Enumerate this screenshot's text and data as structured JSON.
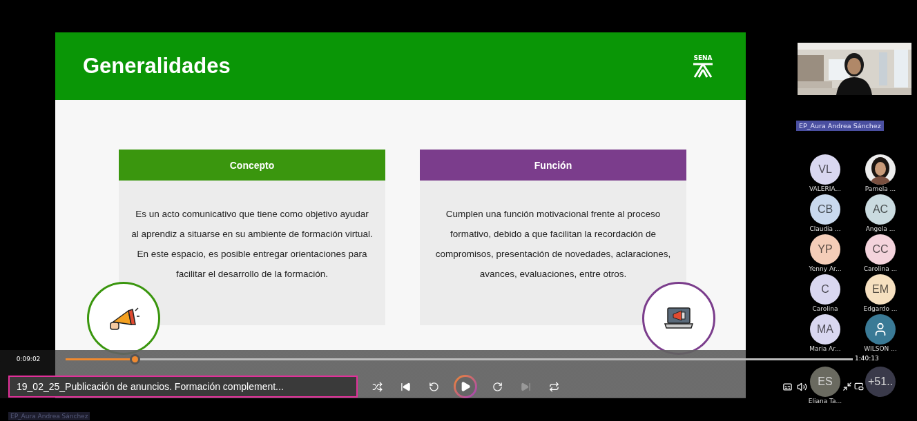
{
  "slide": {
    "title": "Generalidades",
    "logo": "SENA",
    "cards": [
      {
        "heading": "Concepto",
        "color": "#3a960e",
        "kind": "megaphone",
        "body": "Es un acto comunicativo que tiene como objetivo ayudar al aprendiz a situarse en su ambiente de formación virtual. En este espacio, es posible entregar orientaciones para facilitar el desarrollo de la formación."
      },
      {
        "heading": "Función",
        "color": "#7b3d8c",
        "kind": "laptop",
        "body": "Cumplen una función motivacional frente al proceso formativo, debido a que facilitan la recordación de compromisos, presentación de novedades, aclaraciones, avances, evaluaciones, entre otros."
      }
    ]
  },
  "player": {
    "elapsed": "0:09:02",
    "duration": "1:40:13",
    "level": 0.088,
    "title": "19_02_25_Publicación de anuncios. Formación complement..."
  },
  "meeting": {
    "presenter": {
      "name": "EP_Aura Andrea Sánchez",
      "kind": "picture"
    },
    "participants": [
      {
        "kind": "initials",
        "initials": "VL",
        "name": "VALERIA...",
        "color": "#d9d7f0"
      },
      {
        "name": "Pamela ..."
      },
      {
        "kind": "initials",
        "initials": "CB",
        "name": "Claudia ...",
        "color": "#c9d9ee"
      },
      {
        "kind": "initials",
        "initials": "AC",
        "name": "Angela ...",
        "color": "#cadbe0"
      },
      {
        "kind": "initials",
        "initials": "YP",
        "name": "Yenny Ar...",
        "color": "#f4cdb8"
      },
      {
        "kind": "initials",
        "initials": "CC",
        "name": "Carolina ...",
        "color": "#f4d3dc"
      },
      {
        "kind": "initials",
        "initials": "C",
        "name": "Carolina",
        "color": "#d9d7f0"
      },
      {
        "kind": "initials",
        "initials": "EM",
        "name": "Edgardo ...",
        "color": "#f6e0c0"
      },
      {
        "kind": "initials",
        "initials": "MA",
        "name": "Maria Ar...",
        "color": "#d9d7f0"
      },
      {
        "kind": "icon",
        "name": "WILSON ...",
        "color": "#3a7a96"
      },
      {
        "kind": "initials",
        "initials": "ES",
        "name": "Eliana Ta...",
        "color": "#6a6a60"
      },
      {
        "kind": "more",
        "initials": "+51..",
        "color": "#3a3a4a"
      }
    ]
  },
  "footer_tag": "EP_Aura Andrea Sánchez"
}
